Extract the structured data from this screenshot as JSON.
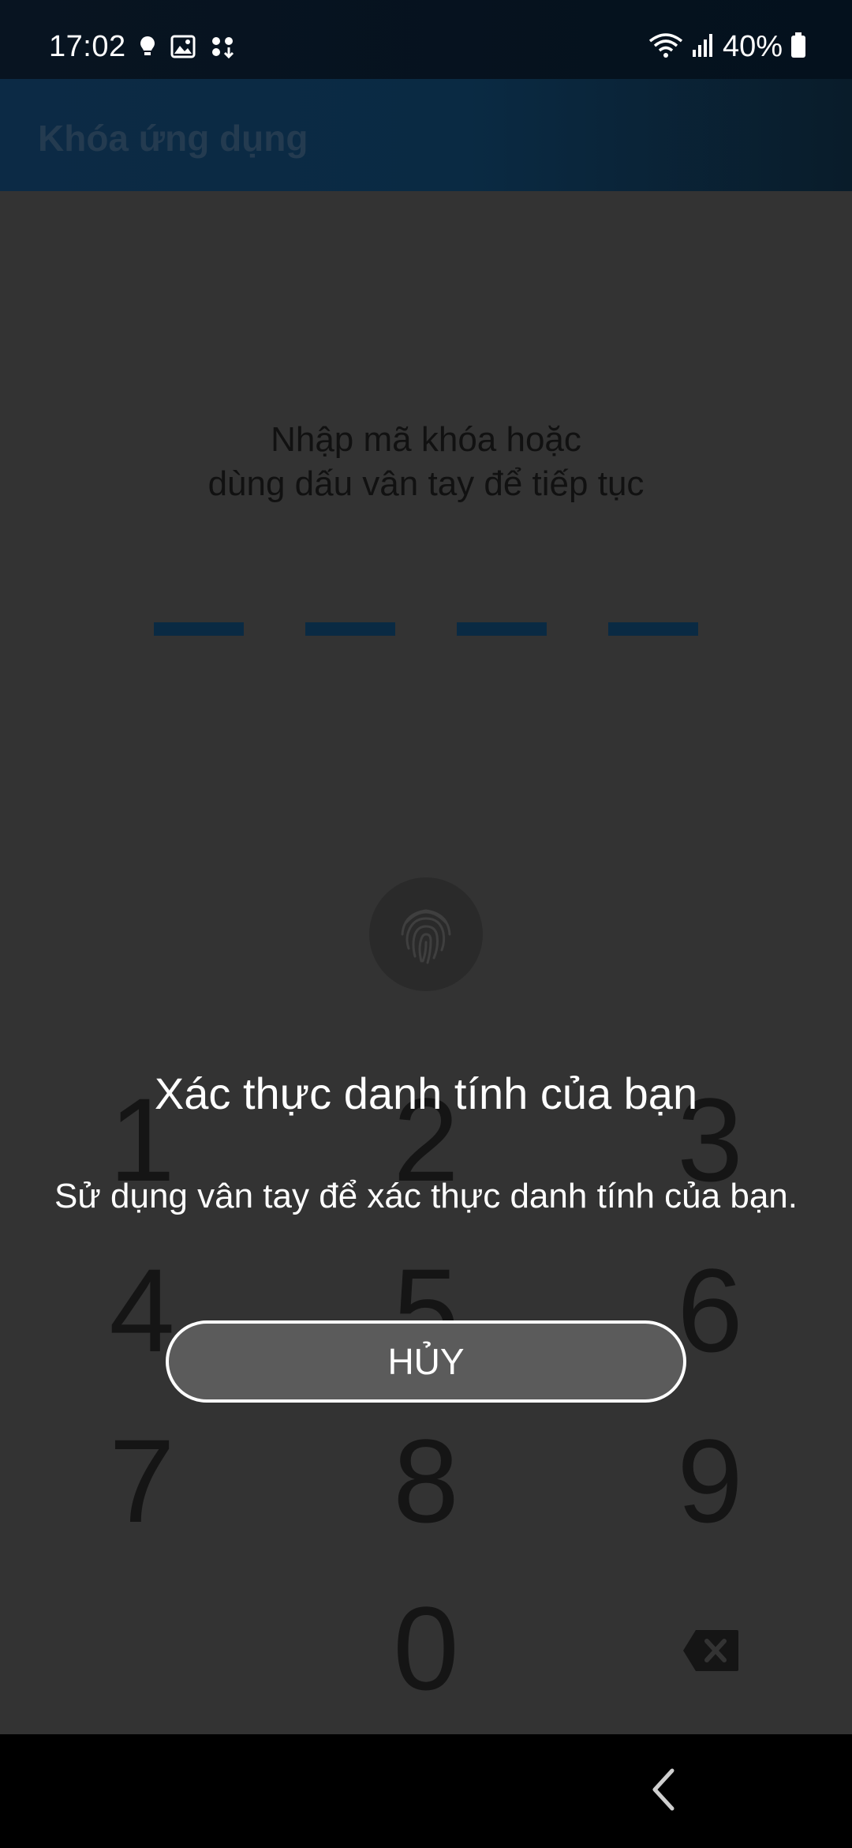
{
  "status_bar": {
    "time": "17:02",
    "left_icons": [
      "bulb-icon",
      "image-icon",
      "apps-icon"
    ],
    "right_icons": [
      "wifi-icon",
      "signal-icon",
      "battery-icon"
    ],
    "battery_text": "40%"
  },
  "app_bar": {
    "title": "Khóa ứng dụng"
  },
  "lock_screen": {
    "prompt_line1": "Nhập mã khóa hoặc",
    "prompt_line2": "dùng dấu vân tay để tiếp tục",
    "pin_length": 4,
    "fingerprint_icon": "fingerprint-icon",
    "keypad": [
      "1",
      "2",
      "3",
      "4",
      "5",
      "6",
      "7",
      "8",
      "9",
      "0"
    ],
    "backspace_icon": "backspace-icon"
  },
  "biometric_dialog": {
    "title": "Xác thực danh tính của bạn",
    "description": "Sử dụng vân tay để xác thực danh tính của bạn.",
    "cancel_label": "HỦY"
  },
  "nav_bar": {
    "back_icon": "back-icon"
  },
  "colors": {
    "background": "#333333",
    "accent": "#0a2a43",
    "status_bar": "#081421",
    "dialog_button": "#5b5b5b"
  }
}
